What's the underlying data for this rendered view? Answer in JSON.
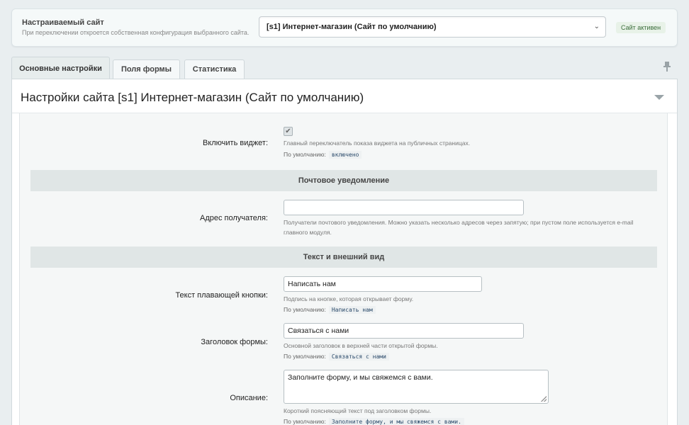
{
  "site_selector": {
    "title": "Настраиваемый сайт",
    "hint": "При переключении откроется собственная конфигурация выбранного сайта.",
    "selected": "[s1] Интернет-магазин (Сайт по умолчанию)",
    "status": "Сайт активен"
  },
  "tabs": [
    {
      "label": "Основные настройки",
      "active": true
    },
    {
      "label": "Поля формы",
      "active": false
    },
    {
      "label": "Статистика",
      "active": false
    }
  ],
  "panel": {
    "title": "Настройки сайта [s1] Интернет-магазин (Сайт по умолчанию)"
  },
  "default_label": "По умолчанию:",
  "fields": {
    "enable_widget": {
      "label": "Включить виджет:",
      "checked": true,
      "help": "Главный переключатель показа виджета на публичных страницах.",
      "default": "включено"
    },
    "recipient": {
      "label": "Адрес получателя:",
      "value": "",
      "help_1": "Получатели почтового уведомления. Можно указать несколько адресов через запятую; при пустом поле используется e-mail",
      "help_2": "главного модуля."
    },
    "button_text": {
      "label": "Текст плавающей кнопки:",
      "value": "Написать нам",
      "help": "Подпись на кнопке, которая открывает форму.",
      "default": "Написать нам"
    },
    "form_title": {
      "label": "Заголовок формы:",
      "value": "Связаться с нами",
      "help": "Основной заголовок в верхней части открытой формы.",
      "default": "Связаться с нами"
    },
    "description": {
      "label": "Описание:",
      "value": "Заполните форму, и мы свяжемся с вами.",
      "help": "Короткий поясняющий текст под заголовком формы.",
      "default": "Заполните форму, и мы свяжемся с вами."
    }
  },
  "sections": {
    "mail": "Почтовое уведомление",
    "appearance": "Текст и внешний вид"
  },
  "colors": {
    "background": "#e9eef0",
    "section_header": "#e0e6e6",
    "status_green": "#3b6e3b"
  }
}
